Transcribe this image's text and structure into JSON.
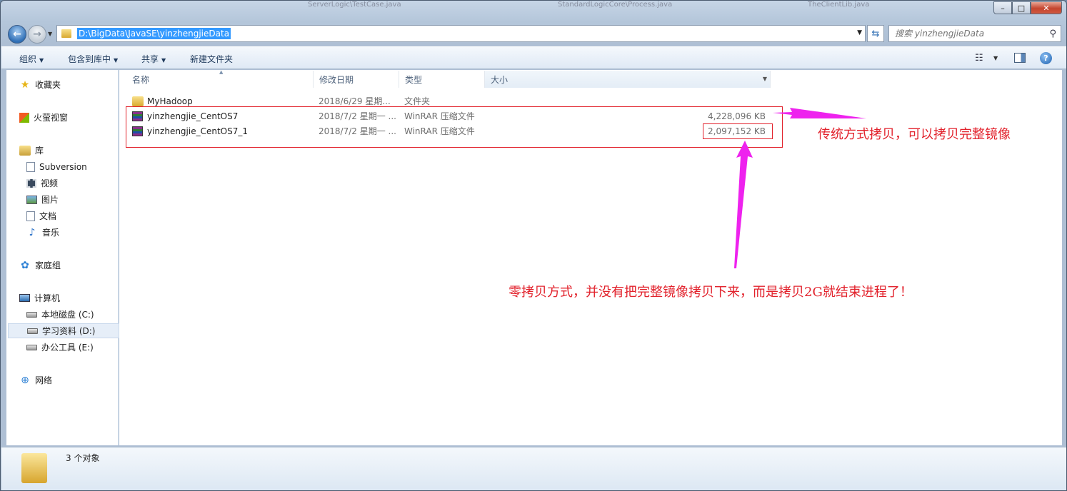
{
  "window": {
    "background_tabs": [
      "ServerLogic\\TestCase.java",
      "StandardLogicCore\\Process.java",
      "TheClientLib.java"
    ]
  },
  "nav": {
    "back_glyph": "←",
    "forward_glyph": "→",
    "recent_glyph": "▼",
    "address": "D:\\BigData\\JavaSE\\yinzhengjieData",
    "address_dropdown_glyph": "▼",
    "refresh_glyph": "⇆",
    "search_placeholder": "搜索 yinzhengjieData",
    "search_icon": "search-icon"
  },
  "toolbar": {
    "organize": "组织",
    "include_in_library": "包含到库中",
    "share": "共享",
    "new_folder": "新建文件夹",
    "caret": "▼",
    "view_glyph": "☷",
    "help_glyph": "?"
  },
  "caption": {
    "minimize": "–",
    "maximize": "□",
    "close": "✕"
  },
  "sidebar": {
    "favorites": "收藏夹",
    "huorong": "火萤视窗",
    "libraries": "库",
    "lib_items": [
      "Subversion",
      "视频",
      "图片",
      "文档",
      "音乐"
    ],
    "homegroup": "家庭组",
    "computer": "计算机",
    "drives": [
      "本地磁盘 (C:)",
      "学习资料 (D:)",
      "办公工具 (E:)"
    ],
    "network": "网络",
    "icon_glyphs": {
      "star": "★",
      "music": "♪",
      "home": "✿",
      "net": "⊕"
    }
  },
  "columns": {
    "name": "名称",
    "date": "修改日期",
    "type": "类型",
    "size": "大小",
    "sort_glyph": "▲",
    "drop_glyph": "▼"
  },
  "files": [
    {
      "name": "MyHadoop",
      "date": "2018/6/29 星期...",
      "type": "文件夹",
      "size": ""
    },
    {
      "name": "yinzhengjie_CentOS7",
      "date": "2018/7/2 星期一 ...",
      "type": "WinRAR 压缩文件",
      "size": "4,228,096 KB"
    },
    {
      "name": "yinzhengjie_CentOS7_1",
      "date": "2018/7/2 星期一 ...",
      "type": "WinRAR 压缩文件",
      "size": "2,097,152 KB"
    }
  ],
  "annotations": {
    "traditional": "传统方式拷贝，可以拷贝完整镜像",
    "zero_copy": "零拷贝方式，并没有把完整镜像拷贝下来，而是拷贝2G就结束进程了！",
    "color": "#e2222c",
    "arrow_color": "#ee22ee"
  },
  "status": {
    "item_count": "3 个对象"
  }
}
